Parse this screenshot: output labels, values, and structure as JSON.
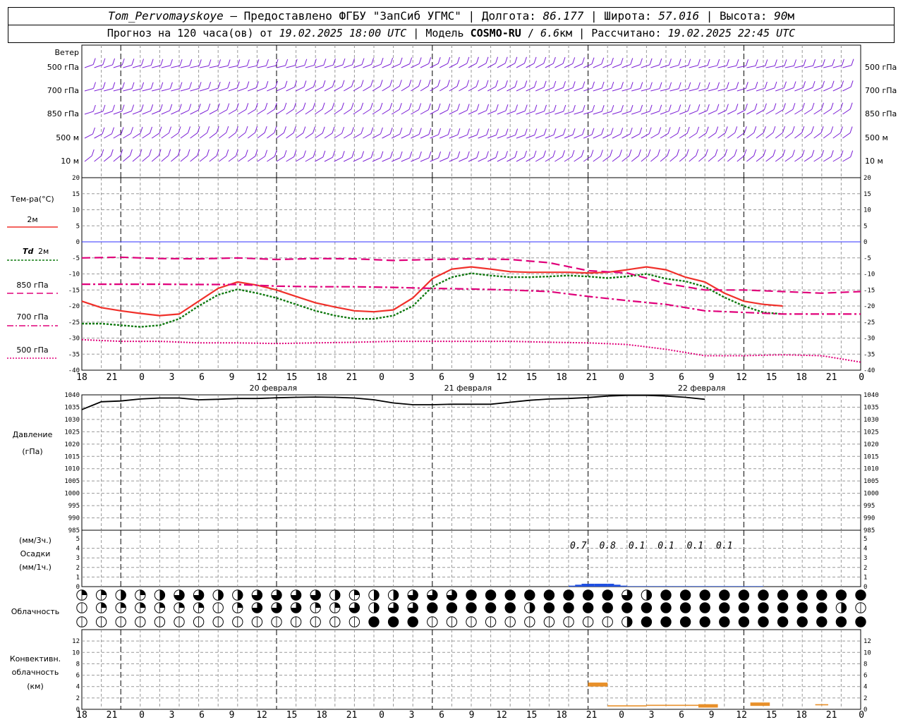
{
  "header": {
    "station": "Tom_Pervomayskoye",
    "provided_by": "Предоставлено ФГБУ \"ЗапСиб УГМС\"",
    "lon_label": "Долгота:",
    "lon": "86.177",
    "lat_label": "Широта:",
    "lat": "57.016",
    "alt_label": "Высота:",
    "alt_value": "90",
    "alt_unit": "м",
    "forecast_label": "Прогноз на 120 часа(ов) от",
    "forecast_from": "19.02.2025 18:00 UTC",
    "model_label": "Модель",
    "model": "COSMO-RU",
    "resolution_value": "6.6",
    "resolution_unit": "км",
    "computed_label": "Рассчитано:",
    "computed": "19.02.2025 22:45 UTC"
  },
  "labels": {
    "wind": "Ветер",
    "wind_levels": [
      "500 гПа",
      "700 гПа",
      "850 гПа",
      "500 м",
      "10 м"
    ],
    "temp": "Тем-ра(°C)",
    "legend_2m": "2м",
    "legend_td_a": "Td",
    "legend_td_b": "2м",
    "legend_850": "850 гПа",
    "legend_700": "700 гПа",
    "legend_500": "500 гПа",
    "pressure_a": "Давление",
    "pressure_b": "(гПа)",
    "precip_a": "(мм/3ч.)",
    "precip_b": "Осадки",
    "precip_c": "(мм/1ч.)",
    "cloud": "Облачность",
    "conv_a": "Конвективн.",
    "conv_b": "облачность",
    "conv_c": "(км)"
  },
  "colors": {
    "wind_barbs": "#7b1fd6",
    "t2m": "#f0302a",
    "td2m": "#117a11",
    "t850": "#e0007a",
    "t700": "#e0007a",
    "t500": "#e0007a",
    "zero_line": "#3030ff",
    "pressure": "#000000",
    "precip": "#1f4fe0",
    "convective": "#e8902a"
  },
  "chart_data": {
    "type": "line",
    "x_unit": "hours from 19.02.2025 18:00 UTC",
    "x_tick_labels": [
      "18",
      "21",
      "0",
      "3",
      "6",
      "9",
      "12",
      "15",
      "18",
      "21",
      "0",
      "3",
      "6",
      "9",
      "12",
      "15",
      "18",
      "21",
      "0",
      "3",
      "6",
      "9",
      "12",
      "15",
      "18",
      "21",
      "0"
    ],
    "day_labels": [
      "20 февраля",
      "21 февраля",
      "22 февраля"
    ],
    "temperature": {
      "ylim": [
        -40,
        20
      ],
      "yticks": [
        20,
        15,
        10,
        5,
        0,
        -5,
        -10,
        -15,
        -20,
        -25,
        -30,
        -35,
        -40
      ],
      "series": [
        {
          "name": "2м",
          "x": [
            0,
            3,
            6,
            9,
            12,
            15,
            18,
            21,
            24,
            27,
            30,
            33,
            36,
            39,
            42,
            45,
            48,
            51,
            54,
            57,
            60,
            63,
            66,
            69,
            72,
            75,
            78,
            81,
            84,
            87,
            90,
            93,
            96,
            99,
            102,
            105,
            108,
            111,
            114,
            117,
            120
          ],
          "values": [
            -18.5,
            -20.5,
            -21.5,
            -22.3,
            -23,
            -22.5,
            -18.5,
            -14.5,
            -12.5,
            -13.5,
            -15,
            -17,
            -19,
            -20.3,
            -21.5,
            -21.8,
            -21.2,
            -17.5,
            -11.5,
            -8.5,
            -7.8,
            -8.5,
            -9.3,
            -9.5,
            -9.5,
            -9.5,
            -9.7,
            -9.5,
            -8.7,
            -7.8,
            -8.7,
            -11,
            -12.5,
            -16,
            -18.5,
            -19.5,
            -20
          ]
        },
        {
          "name": "Td 2м",
          "x": [
            0,
            3,
            6,
            9,
            12,
            15,
            18,
            21,
            24,
            27,
            30,
            33,
            36,
            39,
            42,
            45,
            48,
            51,
            54,
            57,
            60,
            63,
            66,
            69,
            72,
            75,
            78,
            81,
            84,
            87,
            90,
            93,
            96,
            99,
            102,
            105,
            108,
            111,
            114,
            117,
            120
          ],
          "values": [
            -25.5,
            -25.5,
            -26,
            -26.5,
            -26,
            -24,
            -20,
            -16.5,
            -14.8,
            -16,
            -17.5,
            -19.5,
            -21.5,
            -23,
            -24,
            -24,
            -23,
            -20,
            -14,
            -11,
            -9.8,
            -10.5,
            -11,
            -11,
            -10.8,
            -10.5,
            -10.8,
            -11.3,
            -10.8,
            -10,
            -11.5,
            -12.3,
            -14,
            -17.3,
            -20,
            -22,
            -22.5
          ]
        },
        {
          "name": "850 гПа",
          "x": [
            0,
            6,
            12,
            18,
            24,
            30,
            36,
            42,
            48,
            54,
            60,
            66,
            72,
            78,
            84,
            90,
            96,
            102,
            108,
            114,
            120
          ],
          "values": [
            -5,
            -4.8,
            -5.2,
            -5.3,
            -5,
            -5.5,
            -5.2,
            -5.3,
            -5.8,
            -5.5,
            -5.3,
            -5.5,
            -6.5,
            -9,
            -9.7,
            -13,
            -15,
            -15,
            -15.5,
            -16,
            -15.5
          ]
        },
        {
          "name": "700 гПа",
          "x": [
            0,
            6,
            12,
            18,
            24,
            30,
            36,
            42,
            48,
            54,
            60,
            66,
            72,
            78,
            84,
            90,
            96,
            102,
            108,
            114,
            120
          ],
          "values": [
            -13.2,
            -13.2,
            -13.2,
            -13.3,
            -13.3,
            -13.8,
            -14,
            -14,
            -14.2,
            -14.5,
            -14.7,
            -15,
            -15.5,
            -17,
            -18.3,
            -19.5,
            -21.5,
            -22,
            -22.5,
            -22.5,
            -22.5
          ]
        },
        {
          "name": "500 гПа",
          "x": [
            0,
            6,
            12,
            18,
            24,
            30,
            36,
            42,
            48,
            54,
            60,
            66,
            72,
            78,
            84,
            90,
            96,
            102,
            108,
            114,
            120
          ],
          "values": [
            -30.5,
            -31,
            -31,
            -31.5,
            -31.5,
            -31.7,
            -31.5,
            -31.3,
            -31,
            -31,
            -31,
            -31,
            -31.3,
            -31.5,
            -32,
            -33.5,
            -35.5,
            -35.5,
            -35.2,
            -35.5,
            -37.5
          ]
        }
      ]
    },
    "pressure": {
      "ylim": [
        985,
        1040
      ],
      "yticks": [
        1040,
        1035,
        1030,
        1025,
        1020,
        1015,
        1010,
        1005,
        1000,
        995,
        990,
        985
      ],
      "x": [
        0,
        3,
        6,
        9,
        12,
        15,
        18,
        21,
        24,
        27,
        30,
        33,
        36,
        39,
        42,
        45,
        48,
        51,
        54,
        57,
        60,
        63,
        66,
        69,
        72,
        75,
        78,
        81,
        84,
        87,
        90,
        93,
        96,
        99,
        102,
        105,
        108,
        111,
        114,
        117,
        120
      ],
      "values": [
        1034,
        1037.2,
        1037.5,
        1038.3,
        1038.7,
        1038.7,
        1038,
        1038.2,
        1038.5,
        1038.5,
        1038.8,
        1039,
        1039.1,
        1039,
        1038.7,
        1038,
        1036.7,
        1036,
        1036,
        1036.2,
        1036.2,
        1036.2,
        1037,
        1037.8,
        1038.3,
        1038.5,
        1038.9,
        1039.5,
        1039.8,
        1039.8,
        1039.5,
        1039,
        1038.2
      ]
    },
    "precipitation": {
      "ylim": [
        0,
        5
      ],
      "yticks": [
        5,
        4,
        3,
        2,
        1,
        0
      ],
      "x": [
        75,
        76,
        77,
        78,
        79,
        80,
        81,
        82,
        83,
        84,
        85,
        86,
        87,
        88,
        89,
        90,
        91,
        92,
        93,
        94,
        95,
        96,
        97,
        98,
        99,
        100,
        101,
        102,
        103,
        104
      ],
      "values": [
        0.1,
        0.2,
        0.3,
        0.3,
        0.3,
        0.3,
        0.3,
        0.2,
        0.1,
        0.05,
        0.05,
        0.05,
        0.05,
        0.05,
        0.05,
        0.05,
        0.05,
        0.05,
        0.05,
        0.05,
        0.05,
        0.05,
        0.05,
        0.05,
        0.05,
        0.05,
        0.05,
        0.05,
        0.05,
        0.05
      ],
      "labels_3h": [
        {
          "x": 76.5,
          "text": "0.7"
        },
        {
          "x": 81,
          "text": "0.8"
        },
        {
          "x": 85.5,
          "text": "0.1"
        },
        {
          "x": 90,
          "text": "0.1"
        },
        {
          "x": 94.5,
          "text": "0.1"
        },
        {
          "x": 99,
          "text": "0.1"
        }
      ]
    },
    "cloudiness": {
      "rows": 3,
      "count": 41,
      "row1": [
        1,
        1,
        2,
        1,
        2,
        3,
        3,
        2,
        2,
        3,
        3,
        3,
        3,
        2,
        1,
        2,
        2,
        3,
        3,
        3,
        4,
        4,
        4,
        4,
        4,
        4,
        4,
        4,
        3,
        2,
        4,
        4,
        4,
        4,
        4,
        4,
        4,
        4,
        4,
        4,
        4
      ],
      "row2": [
        0,
        1,
        1,
        1,
        1,
        1,
        1,
        0,
        1,
        3,
        3,
        3,
        1,
        1,
        3,
        2,
        3,
        3,
        4,
        4,
        4,
        4,
        4,
        2,
        4,
        4,
        4,
        4,
        4,
        4,
        4,
        4,
        4,
        4,
        4,
        4,
        4,
        4,
        4,
        2,
        0
      ],
      "row3": [
        0,
        0,
        0,
        0,
        0,
        0,
        0,
        0,
        0,
        0,
        0,
        0,
        0,
        0,
        0,
        4,
        4,
        4,
        0,
        0,
        0,
        0,
        0,
        0,
        0,
        0,
        0,
        0,
        2,
        4,
        4,
        4,
        4,
        4,
        4,
        4,
        4,
        4,
        4,
        4,
        4
      ]
    },
    "convective": {
      "ylim": [
        0,
        14
      ],
      "yticks": [
        12,
        10,
        8,
        6,
        4,
        2,
        0
      ],
      "bars": [
        {
          "x0": 78,
          "x1": 81,
          "bottom": 4,
          "top": 4.7
        },
        {
          "x0": 81,
          "x1": 87,
          "bottom": 0.5,
          "top": 0.7
        },
        {
          "x0": 87,
          "x1": 95,
          "bottom": 0.6,
          "top": 0.8
        },
        {
          "x0": 95,
          "x1": 98,
          "bottom": 0.3,
          "top": 0.9
        },
        {
          "x0": 103,
          "x1": 106,
          "bottom": 0.6,
          "top": 1.2
        },
        {
          "x0": 113,
          "x1": 115,
          "bottom": 0.7,
          "top": 0.9
        }
      ]
    }
  }
}
